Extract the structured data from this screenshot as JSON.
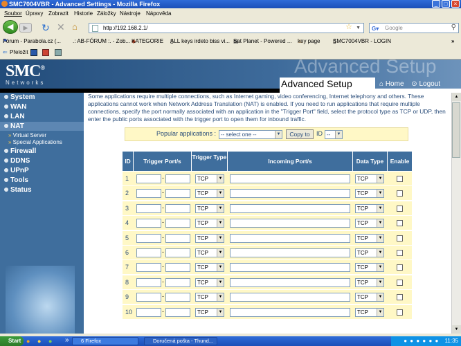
{
  "window": {
    "title": "SMC7004VBR - Advanced Settings - Mozilla Firefox"
  },
  "menu": [
    "Soubor",
    "Úpravy",
    "Zobrazit",
    "Historie",
    "Záložky",
    "Nástroje",
    "Nápověda"
  ],
  "address": {
    "url": "http://192.168.2.1/",
    "search_placeholder": "Google"
  },
  "bookmarks": [
    "Fórum - Parabola.cz (...",
    ".: AB-FÓRUM :. - Zob...",
    "KATEGORIE",
    "ALL keys irdeto biss vi...",
    "Sat Planet - Powered ...",
    "key page",
    "SMC7004VBR - LOGIN"
  ],
  "translate": {
    "label": "Přeložit"
  },
  "router": {
    "logo": "SMC",
    "logo_sub": "Networks",
    "ghost_title": "Advanced Setup",
    "page_title": "Advanced Setup",
    "home": "Home",
    "logout": "Logout"
  },
  "sidebar": {
    "items": [
      "System",
      "WAN",
      "LAN",
      "NAT"
    ],
    "sub_items": [
      "Virtual Server",
      "Special Applications"
    ],
    "items2": [
      "Firewall",
      "DDNS",
      "UPnP",
      "Tools",
      "Status"
    ]
  },
  "intro": "Some applications require multiple connections, such as Internet gaming, video conferencing, Internet telephony and others. These applications cannot work when Network Address Translation (NAT) is enabled. If you need to run applications that require multiple connections, specify the port normally associated with an application in the \"Trigger Port\" field, select the protocol type as TCP or UDP, then enter the public ports associated with the trigger port to open them for inbound traffic.",
  "popular": {
    "label": "Popular applications :",
    "select": "-- select one --",
    "copy": "Copy to",
    "id_label": "ID",
    "id_value": "--"
  },
  "table": {
    "headers": [
      "ID",
      "Trigger Port/s",
      "Trigger Type",
      "Incoming Port/s",
      "Data Type",
      "Enable"
    ],
    "rows": [
      "1",
      "2",
      "3",
      "4",
      "5",
      "6",
      "7",
      "8",
      "9",
      "10"
    ],
    "tcp": "TCP"
  },
  "taskbar": {
    "start": "Start",
    "task1": "6 Firefox",
    "task2": "Doručená pošta - Thund...",
    "clock": "11:35"
  }
}
